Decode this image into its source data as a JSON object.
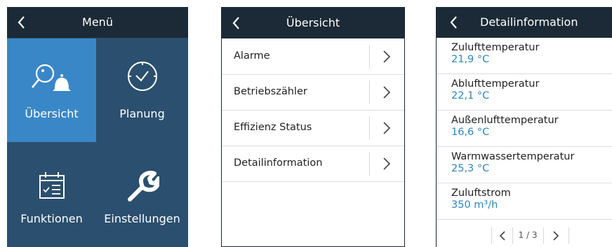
{
  "menu": {
    "title": "Menü",
    "tiles": [
      {
        "label": "Übersicht",
        "icon": "search-bell-icon",
        "color": "#3a87c7"
      },
      {
        "label": "Planung",
        "icon": "clock-icon",
        "color": "#2b4f6e"
      },
      {
        "label": "Funktionen",
        "icon": "calendar-list-icon",
        "color": "#2b4f6e"
      },
      {
        "label": "Einstellungen",
        "icon": "wrench-icon",
        "color": "#2b4f6e"
      }
    ]
  },
  "overview": {
    "title": "Übersicht",
    "items": [
      "Alarme",
      "Betriebszähler",
      "Effizienz Status",
      "Detailinformation"
    ]
  },
  "detail": {
    "title": "Detailinformation",
    "items": [
      {
        "label": "Zulufttemperatur",
        "value": "21,9 °C"
      },
      {
        "label": "Ablufttemperatur",
        "value": "22,1 °C"
      },
      {
        "label": "Außenlufttemperatur",
        "value": "16,6 °C"
      },
      {
        "label": "Warmwassertemperatur",
        "value": "25,3 °C"
      },
      {
        "label": "Zuluftstrom",
        "value": "350 m³/h"
      }
    ],
    "page": "1 / 3"
  },
  "colors": {
    "header": "#1b2a36",
    "tile": "#2b4f6e",
    "tile_active": "#3a87c7",
    "value": "#2f86c0"
  }
}
